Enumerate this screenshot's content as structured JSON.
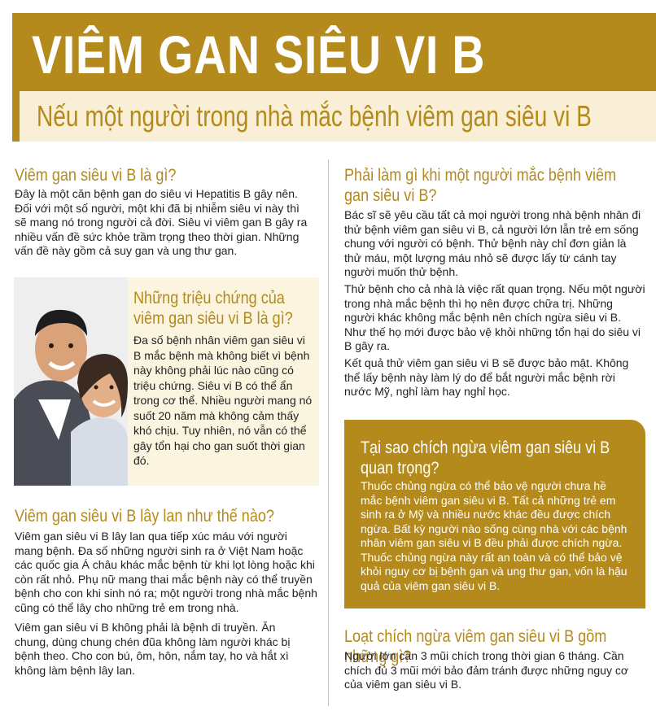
{
  "header": {
    "title": "VIÊM GAN SIÊU VI B",
    "subtitle": "Nếu một người trong nhà mắc bệnh viêm gan siêu vi B"
  },
  "colors": {
    "accent": "#b48a1c",
    "band": "#f8efd6",
    "text": "#231f20"
  },
  "left": {
    "what_is": {
      "heading": "Viêm gan siêu vi B là gì?",
      "body": "Đây là một căn bệnh gan do siêu vi Hepatitis B gây nên. Đối với một số người, một khi đã bị nhiễm siêu vi này thì sẽ mang nó trong người cả đời. Siêu vi viêm gan B gây ra nhiều vấn đề sức khỏe trầm trọng theo thời gian. Những vấn đề này gồm cả suy gan và ung thư gan."
    },
    "symptoms": {
      "photo_icon": "couple-photo",
      "heading": "Những triệu chứng của viêm gan siêu vi B là gì?",
      "body": "Đa số bệnh nhân viêm gan siêu vi B mắc bệnh mà không biết vì bệnh này không phải lúc nào cũng có triệu chứng. Siêu vi B có thể ẩn trong cơ thể. Nhiều người mang nó suốt 20 năm mà không cảm thấy khó chịu. Tuy nhiên, nó vẫn có thể gây tổn hại cho gan suốt thời gian đó."
    },
    "spread": {
      "heading": "Viêm gan siêu vi B lây lan như thế nào?",
      "body1": "Viêm gan siêu vi B lây lan qua tiếp xúc máu với người mang bệnh. Đa số những người sinh ra ở Việt Nam hoặc các quốc gia Á châu khác mắc bệnh từ khi lọt lòng hoặc khi còn rất nhỏ. Phụ nữ mang thai mắc bệnh này có thể truyền bệnh cho con khi sinh nó ra; một người trong nhà mắc bệnh cũng có thể lây cho những trẻ em trong nhà.",
      "body2": "Viêm gan siêu vi B không phải là bệnh di truyền. Ăn chung, dùng chung chén đũa không làm người khác bị bệnh theo. Cho con bú, ôm, hôn, nắm tay, ho và hắt xì không làm bệnh lây lan."
    }
  },
  "right": {
    "what_to_do": {
      "heading": "Phải làm gì khi một người mắc bệnh viêm gan siêu vi B?",
      "body1": "Bác sĩ sẽ yêu cầu tất cả mọi người trong nhà bệnh nhân đi thử bệnh viêm gan siêu vi B, cả người lớn lẫn trẻ em sống chung với người có bệnh. Thử bệnh này chỉ đơn giản là thử máu, một lượng máu nhỏ sẽ được lấy từ cánh tay người muốn thử bệnh.",
      "body2": "Thử bệnh cho cả nhà là việc rất quan trọng. Nếu một người trong nhà mắc bệnh thì họ nên được chữa trị. Những người khác không mắc bệnh nên chích ngừa siêu vi B. Như thế họ mới được bảo vệ khỏi những tổn hại do siêu vi B gây ra.",
      "body3": "Kết quả thử viêm gan siêu vi B sẽ được bảo mật. Không thể lấy bệnh này làm lý do để bắt người mắc bệnh rời nước Mỹ, nghỉ làm hay nghỉ học."
    },
    "why_vaccinate": {
      "heading": "Tại sao chích ngừa viêm gan siêu vi B quan trọng?",
      "body": "Thuốc chủng ngừa có thể bảo vệ người chưa hề mắc bệnh viêm gan siêu vi B. Tất cả những trẻ em sinh ra ở Mỹ và nhiều nước khác đều được chích ngừa. Bất kỳ người nào sống cùng nhà với các bệnh nhân viêm gan siêu vi B đều phải được chích ngừa. Thuốc chủng ngừa này rất an toàn và có thể bảo vệ khỏi nguy cơ bị bệnh gan và ung thư gan, vốn là hậu quả của viêm gan siêu vi B."
    },
    "series": {
      "heading": "Loạt chích ngừa viêm gan siêu vi B gồm những gì?",
      "body": "Người lớn cần 3 mũi chích trong thời gian 6 tháng. Cần chích đủ 3 mũi mới bảo đảm tránh được những nguy cơ của viêm gan siêu vi B."
    }
  }
}
